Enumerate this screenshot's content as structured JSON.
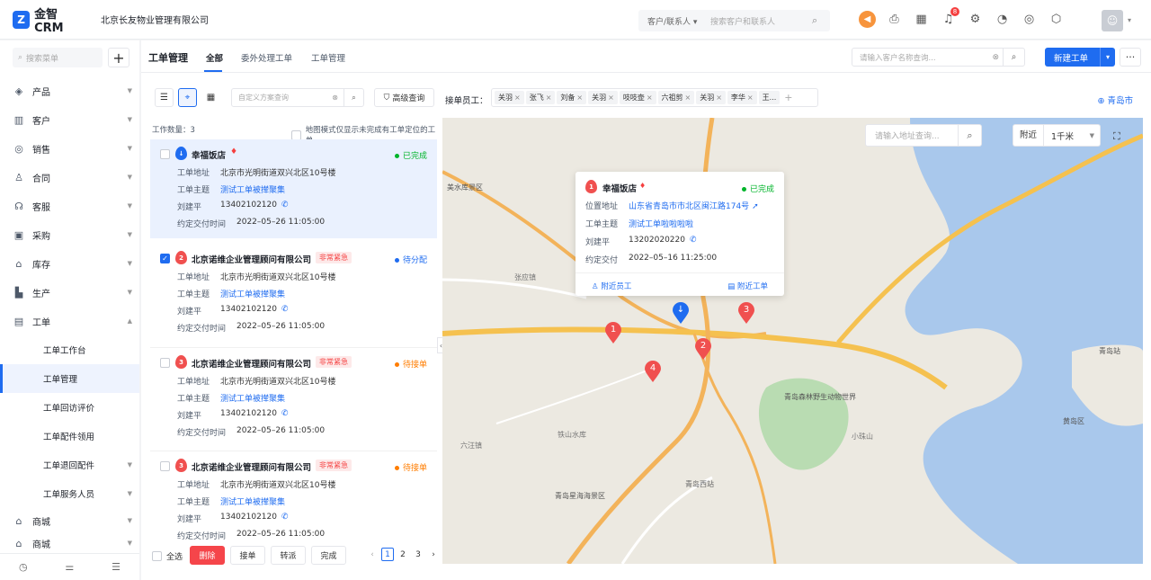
{
  "app": {
    "logo": "金智CRM",
    "company": "北京长友物业管理有限公司"
  },
  "topsearch": {
    "scope": "客户/联系人",
    "placeholder": "搜索客户和联系人"
  },
  "notifications": {
    "count": "8"
  },
  "sidebar": {
    "search_placeholder": "搜索菜单",
    "items": [
      {
        "label": "产品",
        "icon": "cube-icon"
      },
      {
        "label": "客户",
        "icon": "building-icon"
      },
      {
        "label": "销售",
        "icon": "target-icon"
      },
      {
        "label": "合同",
        "icon": "stamp-icon"
      },
      {
        "label": "客服",
        "icon": "headset-icon"
      },
      {
        "label": "采购",
        "icon": "bag-icon"
      },
      {
        "label": "库存",
        "icon": "warehouse-icon"
      },
      {
        "label": "生产",
        "icon": "factory-icon"
      },
      {
        "label": "工单",
        "icon": "document-icon"
      }
    ],
    "sub_items": [
      {
        "label": "工单工作台"
      },
      {
        "label": "工单管理"
      },
      {
        "label": "工单回访评价"
      },
      {
        "label": "工单配件领用"
      },
      {
        "label": "工单退回配件"
      },
      {
        "label": "工单服务人员"
      }
    ],
    "extra": [
      {
        "label": "商城"
      },
      {
        "label": "商城"
      }
    ]
  },
  "header": {
    "title": "工单管理",
    "tabs": [
      "全部",
      "委外处理工单",
      "工单管理"
    ],
    "customer_search_placeholder": "请输入客户名称查询...",
    "new_button": "新建工单"
  },
  "filters": {
    "plan_placeholder": "自定义方案查询",
    "advanced": "高级查询",
    "receiver_label": "接单员工：",
    "receivers": [
      "关羽",
      "张飞",
      "刘备",
      "关羽",
      "吱吱壶",
      "六祖剪",
      "关羽",
      "李华",
      "王..."
    ],
    "city": "青岛市"
  },
  "list": {
    "count_text": "工作数量：3",
    "map_mode_text": "地图模式仅显示未完成有工单定位的工单",
    "labels": {
      "address": "工单地址",
      "subject": "工单主题",
      "due": "约定交付时间"
    },
    "cards": [
      {
        "num": "",
        "name": "幸福饭店",
        "urgent": "",
        "status": "已完成",
        "address": "北京市光明街道双兴北区10号楼",
        "subject": "测试工单被撵聚集",
        "contact": "刘建平",
        "phone": "13402102120",
        "due": "2022–05–26 11:05:00"
      },
      {
        "num": "2",
        "name": "北京诺维企业管理顾问有限公司",
        "urgent": "非常紧急",
        "status": "待分配",
        "address": "北京市光明街道双兴北区10号楼",
        "subject": "测试工单被撵聚集",
        "contact": "刘建平",
        "phone": "13402102120",
        "due": "2022–05–26 11:05:00"
      },
      {
        "num": "3",
        "name": "北京诺维企业管理顾问有限公司",
        "urgent": "非常紧急",
        "status": "待接单",
        "address": "北京市光明街道双兴北区10号楼",
        "subject": "测试工单被撵聚集",
        "contact": "刘建平",
        "phone": "13402102120",
        "due": "2022–05–26 11:05:00"
      },
      {
        "num": "3",
        "name": "北京诺维企业管理顾问有限公司",
        "urgent": "非常紧急",
        "status": "待接单",
        "address": "北京市光明街道双兴北区10号楼",
        "subject": "测试工单被撵聚集",
        "contact": "刘建平",
        "phone": "13402102120",
        "due": "2022–05–26 11:05:00"
      }
    ],
    "select_all": "全选",
    "actions": [
      "删除",
      "接单",
      "转派",
      "完成"
    ],
    "pages": [
      "1",
      "2",
      "3"
    ]
  },
  "map": {
    "search_placeholder": "请输入地址查询...",
    "nearby_label": "附近",
    "radius": "1千米",
    "popup": {
      "num": "1",
      "name": "幸福饭店",
      "status": "已完成",
      "labels": {
        "location": "位置地址",
        "subject": "工单主题",
        "due": "约定交付"
      },
      "location": "山东省青岛市市北区闽江路174号",
      "subject": "测试工单啦啦啦啦",
      "contact": "刘建平",
      "phone": "13202020220",
      "due": "2022–05–16 11:25:00",
      "nearby_staff": "附近员工",
      "nearby_orders": "附近工单"
    },
    "markers": [
      "1",
      "2",
      "3",
      "4"
    ],
    "place_labels": [
      "美水库景区",
      "张应镇",
      "六汪镇",
      "铁山水库",
      "青岛西站",
      "青岛森林野生动物世界",
      "小珠山",
      "青岛站",
      "黄岛区",
      "青岛星海海景区"
    ]
  },
  "colors": {
    "accent": "#1f6cf0",
    "danger": "#f53f3f",
    "success": "#00b42a",
    "warning": "#ff7d00"
  }
}
